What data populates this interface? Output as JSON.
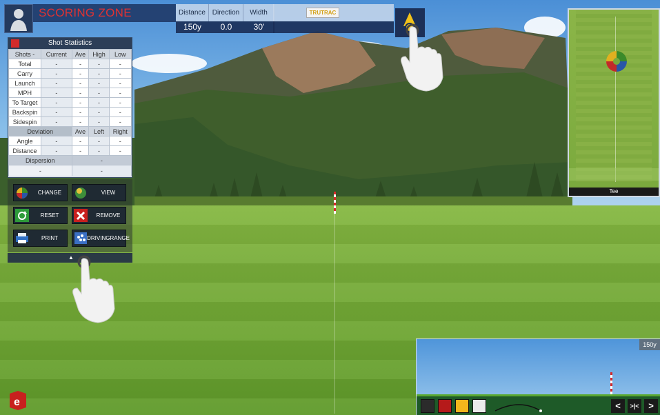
{
  "header": {
    "title": "SCORING ZONE",
    "metrics": [
      {
        "label": "Distance",
        "value": "150y"
      },
      {
        "label": "Direction",
        "value": "0.0"
      },
      {
        "label": "Width",
        "value": "30'"
      }
    ],
    "brand_badge": "TRUTRAC"
  },
  "stats": {
    "title": "Shot Statistics",
    "columns": [
      "Shots -",
      "Current",
      "Ave",
      "High",
      "Low"
    ],
    "rows": [
      {
        "label": "Total",
        "values": [
          "-",
          "-",
          "-",
          "-"
        ]
      },
      {
        "label": "Carry",
        "values": [
          "-",
          "-",
          "-",
          "-"
        ]
      },
      {
        "label": "Launch",
        "values": [
          "-",
          "-",
          "-",
          "-"
        ]
      },
      {
        "label": "MPH",
        "values": [
          "-",
          "-",
          "-",
          "-"
        ]
      },
      {
        "label": "To Target",
        "values": [
          "-",
          "-",
          "-",
          "-"
        ]
      },
      {
        "label": "Backspin",
        "values": [
          "-",
          "-",
          "-",
          "-"
        ]
      },
      {
        "label": "Sidespin",
        "values": [
          "-",
          "-",
          "-",
          "-"
        ]
      }
    ],
    "deviation_columns": [
      "Deviation",
      "Ave",
      "Left",
      "Right"
    ],
    "deviation_rows": [
      {
        "label": "Angle",
        "values": [
          "-",
          "-",
          "-",
          "-"
        ]
      },
      {
        "label": "Distance",
        "values": [
          "-",
          "-",
          "-",
          "-"
        ]
      }
    ],
    "dispersion": {
      "label": "Dispersion",
      "values": [
        "-",
        "-",
        "-"
      ]
    }
  },
  "buttons": {
    "change": "CHANGE",
    "view": "VIEW",
    "reset": "RESET",
    "remove": "REMOVE",
    "print": "PRINT",
    "driving_range_1": "DRIVING",
    "driving_range_2": "RANGE"
  },
  "minimap": {
    "tee_label": "Tee"
  },
  "sideview": {
    "distance": "150y"
  },
  "colors": {
    "title_red": "#e03232",
    "swatch_1": "#2b2b2b",
    "swatch_2": "#b51a1a",
    "swatch_3": "#f2b61c",
    "swatch_4": "#ebebeb"
  }
}
